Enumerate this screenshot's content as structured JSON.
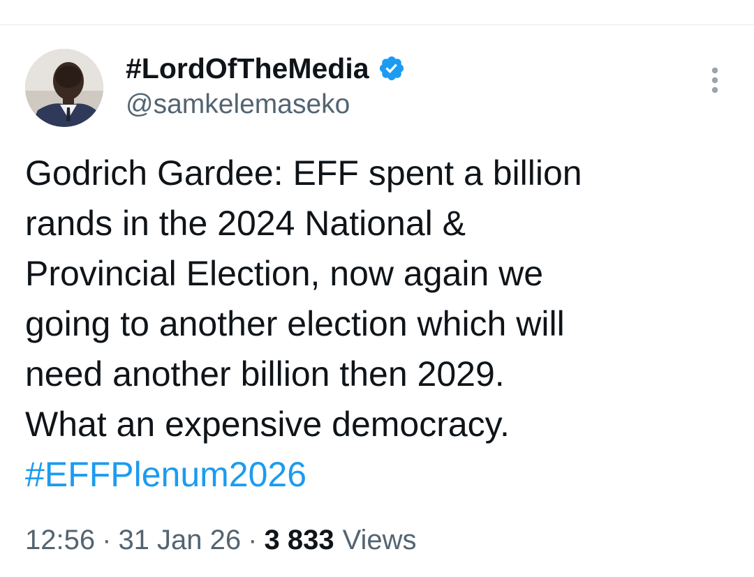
{
  "author": {
    "display_name": "#LordOfTheMedia",
    "handle": "@samkelemaseko",
    "verified": true
  },
  "tweet": {
    "lines": [
      "Godrich Gardee: EFF spent a billion",
      "rands in the 2024 National &",
      "Provincial Election, now again we",
      "going to another election which will",
      "need another billion then 2029.",
      "What an expensive democracy."
    ],
    "hashtag": "#EFFPlenum2026"
  },
  "meta": {
    "time": "12:56",
    "separator": "·",
    "date": "31 Jan 26",
    "views_count": "3 833",
    "views_label": "Views"
  },
  "icons": {
    "more": "more-vertical-icon",
    "verified": "verified-badge-icon"
  },
  "colors": {
    "accent": "#1d9bf0",
    "text": "#0f1419",
    "secondary_text": "#536471",
    "divider": "#e7e9ea"
  }
}
